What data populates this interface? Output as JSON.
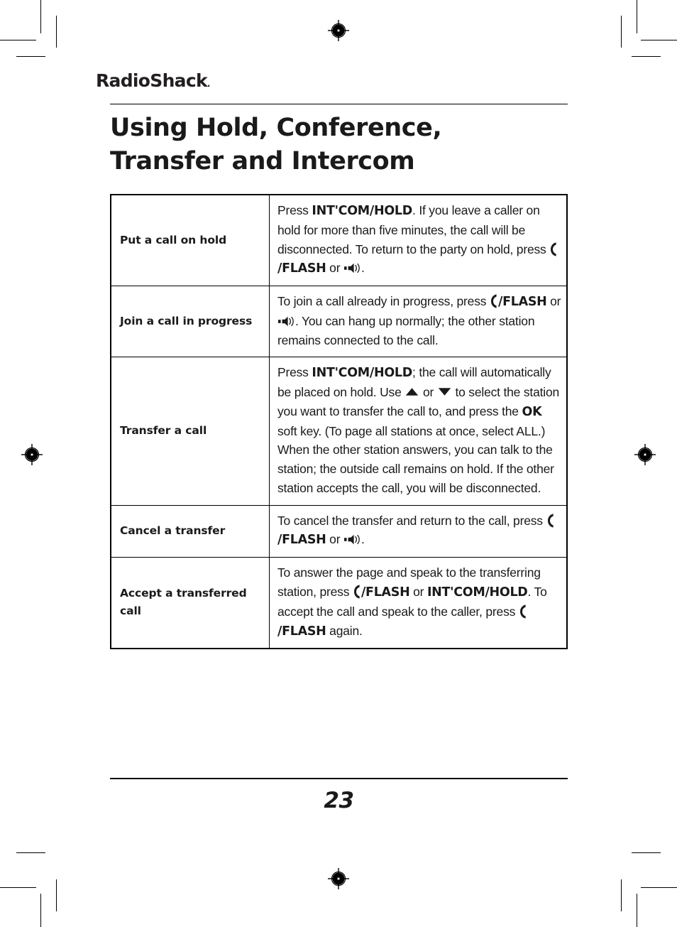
{
  "brand": {
    "name": "RadioShack",
    "dot": "."
  },
  "title": {
    "line1": "Using Hold, Conference,",
    "line2": "Transfer and Intercom"
  },
  "table": {
    "rows": [
      {
        "action": "Put a call on hold",
        "description": "Press INT'COM/HOLD. If you leave a caller on hold for more than five minutes, the call will be disconnected. To return to the party on hold, press [handset]/FLASH or [speaker].",
        "segments": [
          {
            "text": "Press ",
            "style": "plain"
          },
          {
            "text": "INT'COM/HOLD",
            "style": "bold"
          },
          {
            "text": ". If you leave a caller on hold for more than five minutes, the call will be disconnected. To return to the party on hold, press ",
            "style": "plain"
          },
          {
            "text": "handset-icon",
            "style": "icon"
          },
          {
            "text": "/FLASH",
            "style": "bold"
          },
          {
            "text": " or ",
            "style": "plain"
          },
          {
            "text": "speaker-icon",
            "style": "icon"
          },
          {
            "text": ".",
            "style": "plain"
          }
        ]
      },
      {
        "action": "Join a call in progress",
        "description": "To join a call already in progress, press [handset]/FLASH or [speaker]. You can hang up normally; the other station remains connected to the call.",
        "segments": [
          {
            "text": "To join a call already in progress, press ",
            "style": "plain"
          },
          {
            "text": "handset-icon",
            "style": "icon"
          },
          {
            "text": "/FLASH",
            "style": "bold"
          },
          {
            "text": " or ",
            "style": "plain"
          },
          {
            "text": "speaker-icon",
            "style": "icon"
          },
          {
            "text": ". You can hang up normally; the other station remains connected to the call.",
            "style": "plain"
          }
        ]
      },
      {
        "action": "Transfer a call",
        "description": "Press INT'COM/HOLD; the call will automatically be placed on hold. Use [up] or [down] to select the station you want to transfer the call to, and press the OK soft key. (To page all stations at once, select ALL.) When the other station answers, you can talk to the station; the outside call remains on hold. If the other station accepts the call, you will be disconnected.",
        "segments": [
          {
            "text": "Press ",
            "style": "plain"
          },
          {
            "text": "INT'COM/HOLD",
            "style": "bold"
          },
          {
            "text": "; the call will automatically be placed on hold. Use ",
            "style": "plain"
          },
          {
            "text": "triangle-up-icon",
            "style": "icon"
          },
          {
            "text": " or ",
            "style": "plain"
          },
          {
            "text": "triangle-down-icon",
            "style": "icon"
          },
          {
            "text": " to select the station you want to transfer the call to, and press the ",
            "style": "plain"
          },
          {
            "text": "OK",
            "style": "bold"
          },
          {
            "text": " soft key. (To page all stations at once, select ALL.) When the other station answers, you can talk to the station; the outside call remains on hold. If the other station accepts the call, you will be disconnected.",
            "style": "plain"
          }
        ]
      },
      {
        "action": "Cancel a transfer",
        "description": "To cancel the transfer and return to the call, press [handset]/FLASH or [speaker].",
        "segments": [
          {
            "text": "To cancel the transfer and return to the call, press ",
            "style": "plain"
          },
          {
            "text": "handset-icon",
            "style": "icon"
          },
          {
            "text": "/FLASH",
            "style": "bold"
          },
          {
            "text": " or ",
            "style": "plain"
          },
          {
            "text": "speaker-icon",
            "style": "icon"
          },
          {
            "text": ".",
            "style": "plain"
          }
        ]
      },
      {
        "action": "Accept a transferred call",
        "description": "To answer the page and speak to the transferring station, press [handset]/FLASH or INT'COM/HOLD. To accept the call and speak to the caller, press [handset]/FLASH again.",
        "segments": [
          {
            "text": "To answer the page and speak to the transferring station, press ",
            "style": "plain"
          },
          {
            "text": "handset-icon",
            "style": "icon"
          },
          {
            "text": "/FLASH",
            "style": "bold"
          },
          {
            "text": " or ",
            "style": "plain"
          },
          {
            "text": "INT'COM/HOLD",
            "style": "bold"
          },
          {
            "text": ". To accept the call and speak to the caller, press ",
            "style": "plain"
          },
          {
            "text": "handset-icon",
            "style": "icon"
          },
          {
            "text": "/FLASH",
            "style": "bold"
          },
          {
            "text": " again.",
            "style": "plain"
          }
        ]
      }
    ]
  },
  "footer": {
    "page_number": "23"
  },
  "colors": {
    "ink": "#1a1a1a",
    "rule": "#000000",
    "paper": "#ffffff"
  }
}
